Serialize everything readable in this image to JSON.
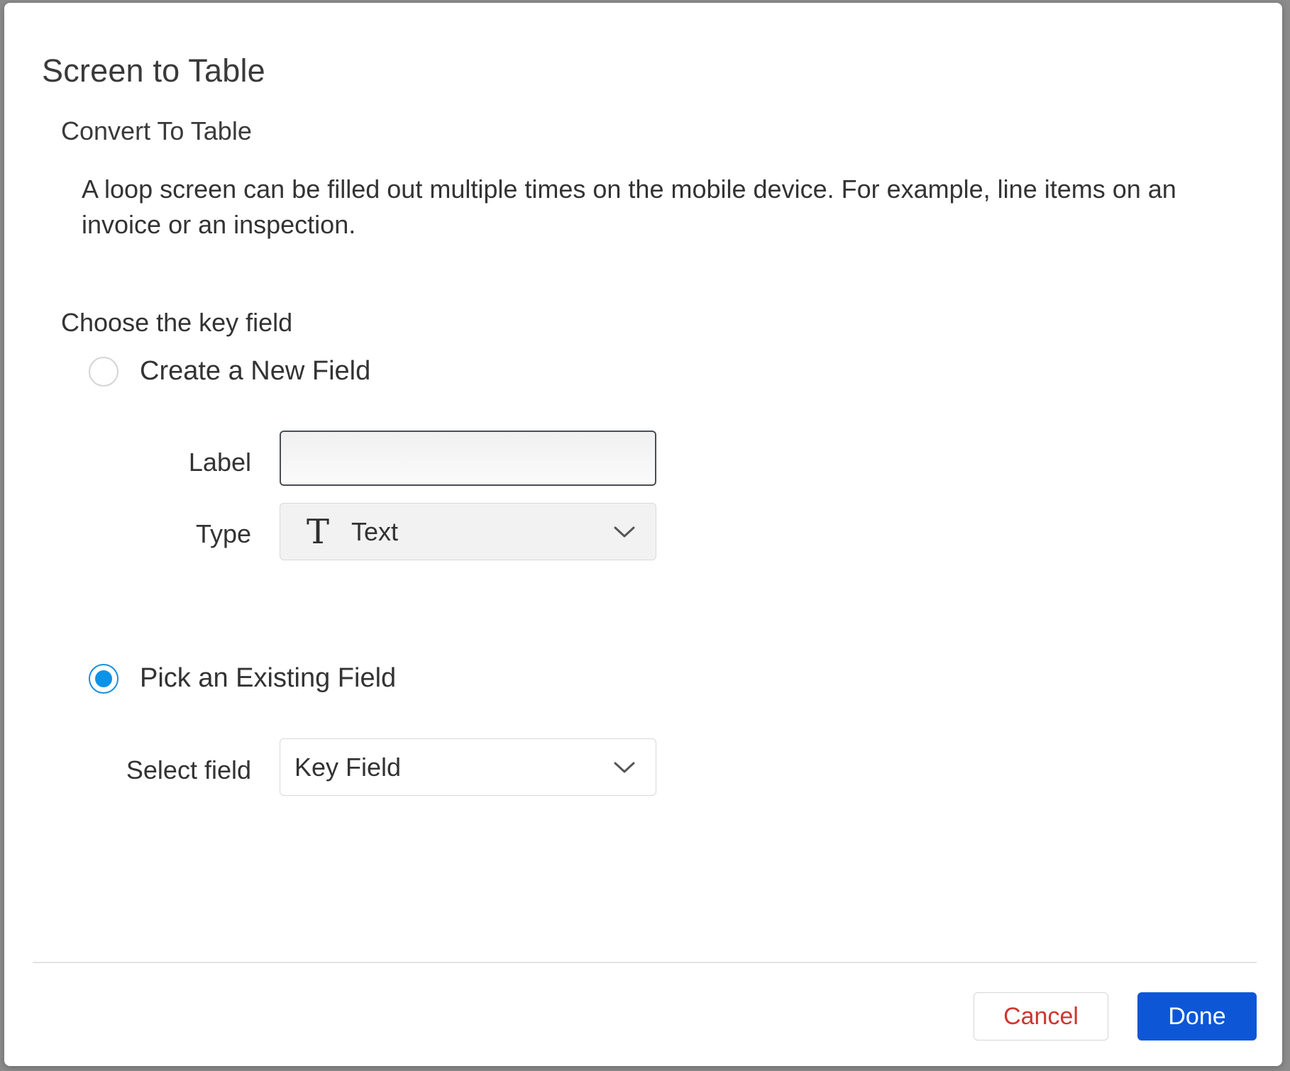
{
  "dialog": {
    "title": "Screen to Table",
    "subtitle": "Convert To Table",
    "description": "A loop screen can be filled out multiple times on the mobile device. For example, line items on an invoice or an inspection."
  },
  "key_field": {
    "section_label": "Choose the key field",
    "options": [
      {
        "label": "Create a New Field",
        "selected": false
      },
      {
        "label": "Pick an Existing Field",
        "selected": true
      }
    ],
    "new_field": {
      "label_caption": "Label",
      "label_value": "",
      "type_caption": "Type",
      "type_icon": "text-type-icon",
      "type_glyph": "T",
      "type_value": "Text"
    },
    "existing_field": {
      "select_caption": "Select field",
      "select_value": "Key Field"
    }
  },
  "footer": {
    "cancel_label": "Cancel",
    "done_label": "Done"
  },
  "colors": {
    "accent_blue": "#0d57d6",
    "radio_blue": "#0b93e8",
    "cancel_red": "#d0362f"
  }
}
